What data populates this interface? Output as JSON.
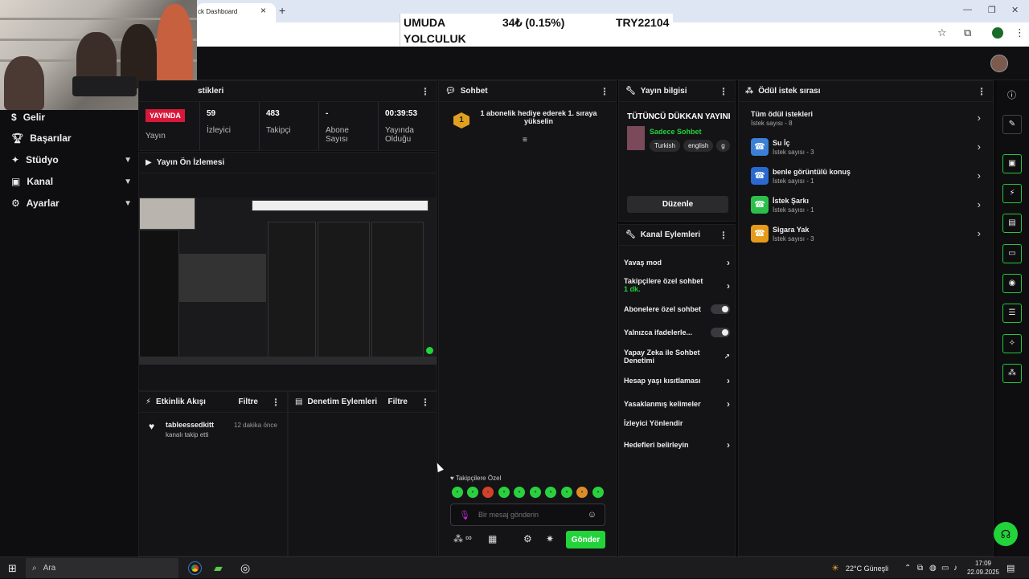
{
  "browser": {
    "tab_title": "ck Dashboard",
    "tab_close": "×",
    "new_tab": "+",
    "win_min": "—",
    "win_max": "❐",
    "win_close": "✕"
  },
  "ticker": {
    "name_line1": "UMUDA",
    "name_line2": "YOLCULUK",
    "price": "34₺ (0.15%)",
    "code": "TRY22104"
  },
  "sidebar": {
    "items": [
      {
        "label": "Gelir",
        "icon": "money-icon"
      },
      {
        "label": "Başarılar",
        "icon": "trophy-icon"
      },
      {
        "label": "Stüdyo",
        "icon": "studio-icon"
      },
      {
        "label": "Kanal",
        "icon": "channel-icon"
      },
      {
        "label": "Ayarlar",
        "icon": "gear-icon"
      }
    ]
  },
  "stats_panel": {
    "title": "stikleri",
    "live_badge": "YAYINDA",
    "live_label": "Yayın",
    "viewers_value": "59",
    "viewers_label": "İzleyici",
    "followers_value": "483",
    "followers_label": "Takipçi",
    "subs_value": "-",
    "subs_label_1": "Abone",
    "subs_label_2": "Sayısı",
    "duration_value": "00:39:53",
    "duration_label_1": "Yayında",
    "duration_label_2": "Olduğu"
  },
  "preview": {
    "title": "Yayın Ön İzlemesi"
  },
  "activity": {
    "title": "Etkinlik Akışı",
    "filter": "Filtre",
    "events": [
      {
        "user": "tableessedkitt",
        "action": "kanalı takip etti",
        "time": "12 dakika önce"
      }
    ]
  },
  "moderation": {
    "title": "Denetim Eylemleri",
    "filter": "Filtre"
  },
  "chat": {
    "title": "Sohbet",
    "badge_number": "1",
    "pinned_message": "1 abonelik hediye ederek 1. sıraya yükselin",
    "followers_only": "Takipçilere Özel",
    "input_placeholder": "Bir mesaj gönderin",
    "send_label": "Gönder",
    "points_label": "∞"
  },
  "stream_info": {
    "title": "Yayın bilgisi",
    "stream_title": "TÜTÜNCÜ DÜKKAN YAYINI",
    "category": "Sadece Sohbet",
    "tags": [
      "Turkish",
      "english",
      "g"
    ],
    "edit_label": "Düzenle"
  },
  "channel_actions": {
    "title": "Kanal Eylemleri",
    "slow_mode": "Yavaş mod",
    "followers_chat": "Takipçilere özel sohbet",
    "followers_chat_value": "1 dk.",
    "subs_chat": "Abonelere özel sohbet",
    "emotes_only": "Yalnızca ifadelerle...",
    "ai_mod_1": "Yapay Zeka ile Sohbet",
    "ai_mod_2": "Denetimi",
    "age_restrict": "Hesap yaşı kısıtlaması",
    "banned_words": "Yasaklanmış kelimeler",
    "redirect": "İzleyici Yönlendir",
    "goals": "Hedefleri belirleyin"
  },
  "rewards": {
    "title": "Ödül istek sırası",
    "all_label": "Tüm ödül istekleri",
    "all_count": "İstek sayısı - 8",
    "items": [
      {
        "name": "Su İç",
        "count": "İstek sayısı - 3",
        "color": "#3b7fd6"
      },
      {
        "name": "benle görüntülü konuş",
        "count": "İstek sayısı - 1",
        "color": "#2a6ad0"
      },
      {
        "name": "İstek Şarkı",
        "count": "İstek sayısı - 1",
        "color": "#2cc04a"
      },
      {
        "name": "Sigara Yak",
        "count": "İstek sayısı - 3",
        "color": "#e69a1a"
      }
    ]
  },
  "taskbar": {
    "search": "Ara",
    "weather": "22°C  Güneşli",
    "time": "17:09",
    "date": "22.09.2025"
  },
  "colors": {
    "accent": "#22d33a",
    "live": "#d8183a",
    "bg": "#0b0b0c"
  }
}
